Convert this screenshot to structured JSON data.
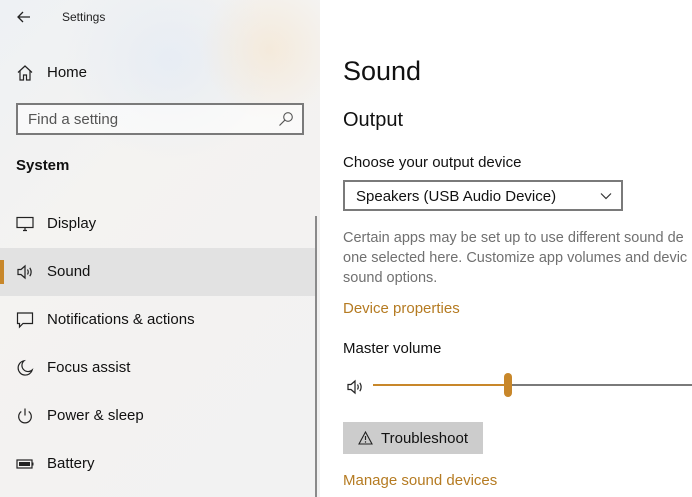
{
  "app": {
    "title": "Settings"
  },
  "nav": {
    "back_icon": "back-arrow-icon",
    "home_label": "Home",
    "home_icon": "home-icon",
    "search": {
      "placeholder": "Find a setting",
      "value": "",
      "icon": "search-icon"
    },
    "section_title": "System",
    "items": [
      {
        "label": "Display",
        "icon": "display-icon",
        "selected": false
      },
      {
        "label": "Sound",
        "icon": "speaker-icon",
        "selected": true
      },
      {
        "label": "Notifications & actions",
        "icon": "notification-icon",
        "selected": false
      },
      {
        "label": "Focus assist",
        "icon": "moon-icon",
        "selected": false
      },
      {
        "label": "Power & sleep",
        "icon": "power-icon",
        "selected": false
      },
      {
        "label": "Battery",
        "icon": "battery-icon",
        "selected": false
      }
    ]
  },
  "main": {
    "title": "Sound",
    "output_heading": "Output",
    "device_label": "Choose your output device",
    "device_selected": "Speakers (USB Audio Device)",
    "description_lines": [
      "Certain apps may be set up to use different sound de",
      "one selected here. Customize app volumes and devic",
      "sound options."
    ],
    "device_properties_link": "Device properties",
    "master_volume_label": "Master volume",
    "master_volume_fraction": 0.41,
    "troubleshoot_label": "Troubleshoot",
    "manage_devices_link": "Manage sound devices"
  },
  "colors": {
    "accent": "#c8872a",
    "link": "#b57b22",
    "selected_bg": "#e2e2e2",
    "button_bg": "#cccccc"
  }
}
